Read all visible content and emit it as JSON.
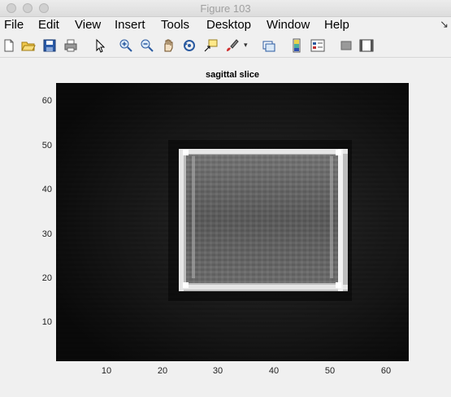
{
  "window": {
    "title": "Figure 103"
  },
  "menu": [
    "File",
    "Edit",
    "View",
    "Insert",
    "Tools",
    "Desktop",
    "Window",
    "Help"
  ],
  "plot": {
    "title": "sagittal slice",
    "yticks": [
      "60",
      "50",
      "40",
      "30",
      "20",
      "10"
    ],
    "xticks": [
      "10",
      "20",
      "30",
      "40",
      "50",
      "60"
    ]
  },
  "toolbar_icons": [
    "new-figure-icon",
    "open-file-icon",
    "save-icon",
    "print-icon",
    "pointer-icon",
    "zoom-in-icon",
    "zoom-out-icon",
    "pan-icon",
    "rotate-icon",
    "data-cursor-icon",
    "brush-icon",
    "link-plot-icon",
    "insert-colorbar-icon",
    "insert-legend-icon",
    "hide-plot-tools-icon",
    "show-plot-tools-icon"
  ]
}
